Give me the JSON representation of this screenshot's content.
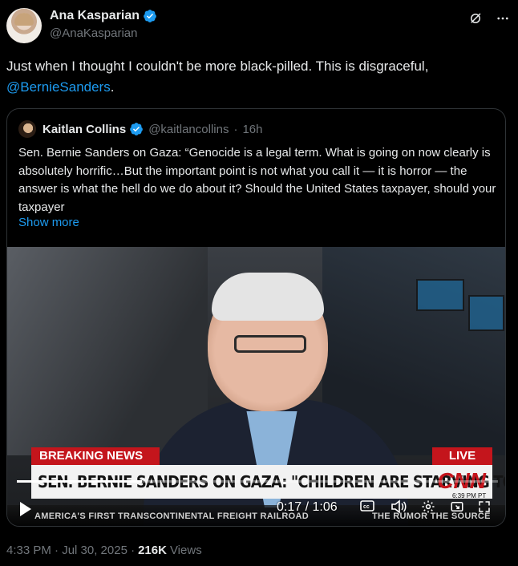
{
  "author": {
    "name": "Ana Kasparian",
    "handle": "@AnaKasparian"
  },
  "tweet": {
    "text_before": "Just when I thought I couldn't be more black-pilled. This is disgraceful,",
    "mention": "@BernieSanders",
    "text_after": "."
  },
  "quote": {
    "name": "Kaitlan Collins",
    "handle": "@kaitlancollins",
    "separator": "·",
    "age": "16h",
    "text": "Sen. Bernie Sanders on Gaza: “Genocide is a legal term. What is going on now clearly is absolutely horrific…But the important point is not what you call it — it is horror — the answer is what the hell do we do about it? Should the United States taxpayer, should your taxpayer",
    "show_more": "Show more"
  },
  "video": {
    "breaking_label": "BREAKING NEWS",
    "live_label": "LIVE",
    "chyron": "SEN. BERNIE SANDERS ON GAZA: \"CHILDREN ARE STARVING TO DEATH\"",
    "network": "CNN",
    "network_time": "6:39 PM PT",
    "ticker": "AMERICA'S FIRST TRANSCONTINENTAL FREIGHT RAILROAD",
    "ticker_right": "THE RUMOR THE SOURCE",
    "time_display": "0:17 / 1:06",
    "progress": 0.26
  },
  "footer": {
    "timestamp": "4:33 PM · Jul 30, 2025 ·",
    "views": "216K",
    "views_label": "Views"
  },
  "colors": {
    "accent": "#1d9bf0",
    "cnn_red": "#c4151c"
  }
}
